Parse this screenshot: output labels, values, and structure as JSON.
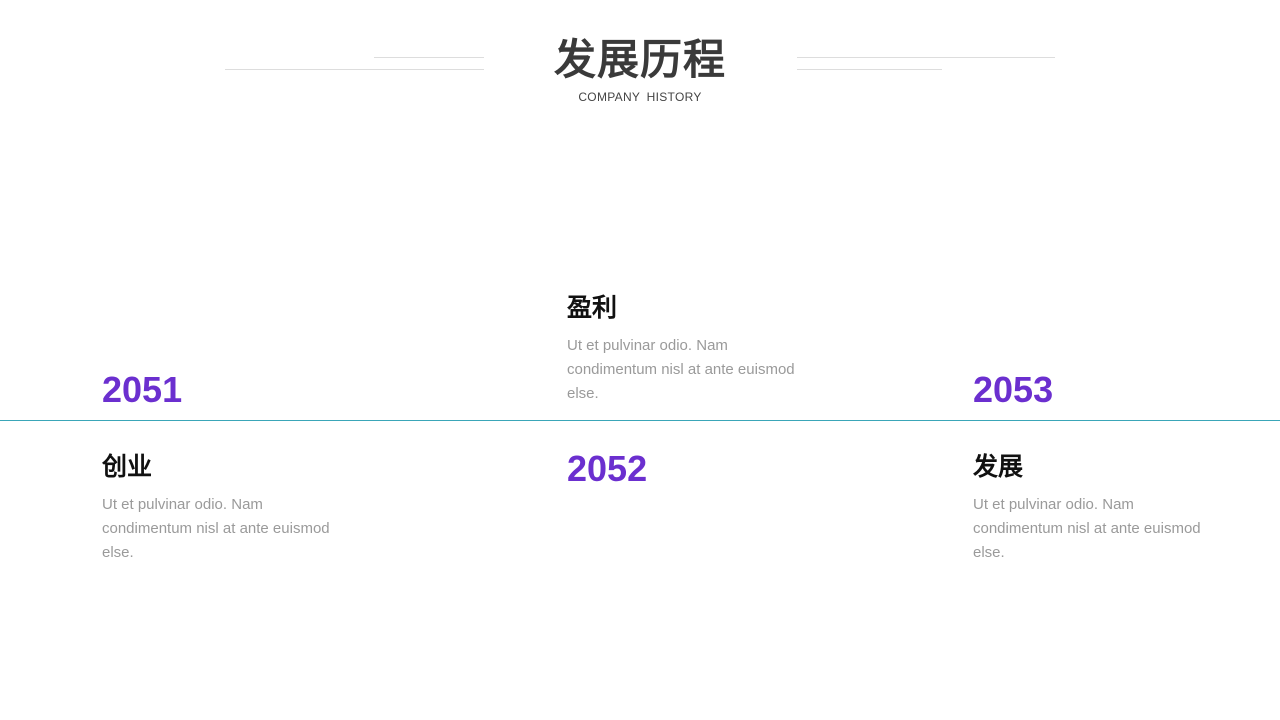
{
  "header": {
    "title": "发展历程",
    "subtitle": "COMPANY  HISTORY"
  },
  "colors": {
    "year": "#6b2fcf",
    "timeline": "#3aa6b8",
    "title": "#3a3a3a",
    "description": "#9a9a9a"
  },
  "milestones": [
    {
      "year": "2051",
      "heading": "创业",
      "description": "Ut et pulvinar odio. Nam condimentum nisl at ante euismod else."
    },
    {
      "year": "2052",
      "heading": "盈利",
      "description": "Ut et pulvinar odio. Nam condimentum nisl at ante euismod else."
    },
    {
      "year": "2053",
      "heading": "发展",
      "description": "Ut et pulvinar odio. Nam condimentum nisl at ante euismod else."
    }
  ]
}
